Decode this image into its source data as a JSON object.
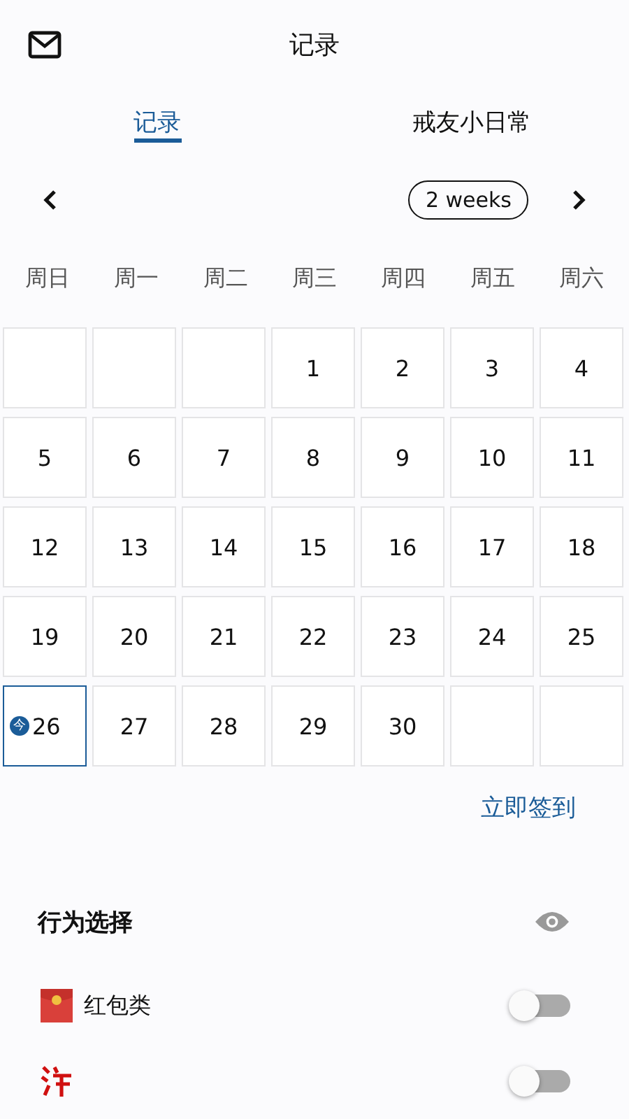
{
  "header": {
    "title": "记录"
  },
  "tabs": [
    {
      "label": "记录",
      "selected": true
    },
    {
      "label": "戒友小日常",
      "selected": false
    }
  ],
  "range_button": {
    "label": "2 weeks"
  },
  "weekdays": [
    "周日",
    "周一",
    "周二",
    "周三",
    "周四",
    "周五",
    "周六"
  ],
  "cells": [
    {
      "kind": "empty"
    },
    {
      "kind": "empty"
    },
    {
      "kind": "empty"
    },
    {
      "kind": "day",
      "day": "1",
      "today": false
    },
    {
      "kind": "day",
      "day": "2",
      "today": false
    },
    {
      "kind": "day",
      "day": "3",
      "today": false
    },
    {
      "kind": "day",
      "day": "4",
      "today": false
    },
    {
      "kind": "day",
      "day": "5",
      "today": false
    },
    {
      "kind": "day",
      "day": "6",
      "today": false
    },
    {
      "kind": "day",
      "day": "7",
      "today": false
    },
    {
      "kind": "day",
      "day": "8",
      "today": false
    },
    {
      "kind": "day",
      "day": "9",
      "today": false
    },
    {
      "kind": "day",
      "day": "10",
      "today": false
    },
    {
      "kind": "day",
      "day": "11",
      "today": false
    },
    {
      "kind": "day",
      "day": "12",
      "today": false
    },
    {
      "kind": "day",
      "day": "13",
      "today": false
    },
    {
      "kind": "day",
      "day": "14",
      "today": false
    },
    {
      "kind": "day",
      "day": "15",
      "today": false
    },
    {
      "kind": "day",
      "day": "16",
      "today": false
    },
    {
      "kind": "day",
      "day": "17",
      "today": false
    },
    {
      "kind": "day",
      "day": "18",
      "today": false
    },
    {
      "kind": "day",
      "day": "19",
      "today": false
    },
    {
      "kind": "day",
      "day": "20",
      "today": false
    },
    {
      "kind": "day",
      "day": "21",
      "today": false
    },
    {
      "kind": "day",
      "day": "22",
      "today": false
    },
    {
      "kind": "day",
      "day": "23",
      "today": false
    },
    {
      "kind": "day",
      "day": "24",
      "today": false
    },
    {
      "kind": "day",
      "day": "25",
      "today": false
    },
    {
      "kind": "day",
      "day": "26",
      "today": true,
      "today_badge": "今"
    },
    {
      "kind": "day",
      "day": "27",
      "today": false
    },
    {
      "kind": "day",
      "day": "28",
      "today": false
    },
    {
      "kind": "day",
      "day": "29",
      "today": false
    },
    {
      "kind": "day",
      "day": "30",
      "today": false
    },
    {
      "kind": "empty"
    },
    {
      "kind": "empty"
    }
  ],
  "sign_in": {
    "label": "立即签到"
  },
  "behavior_section": {
    "title": "行为选择"
  },
  "behaviors": [
    {
      "kind": "envelope",
      "label": "红包类",
      "on": false
    },
    {
      "kind": "red-glyph",
      "on": false
    }
  ]
}
